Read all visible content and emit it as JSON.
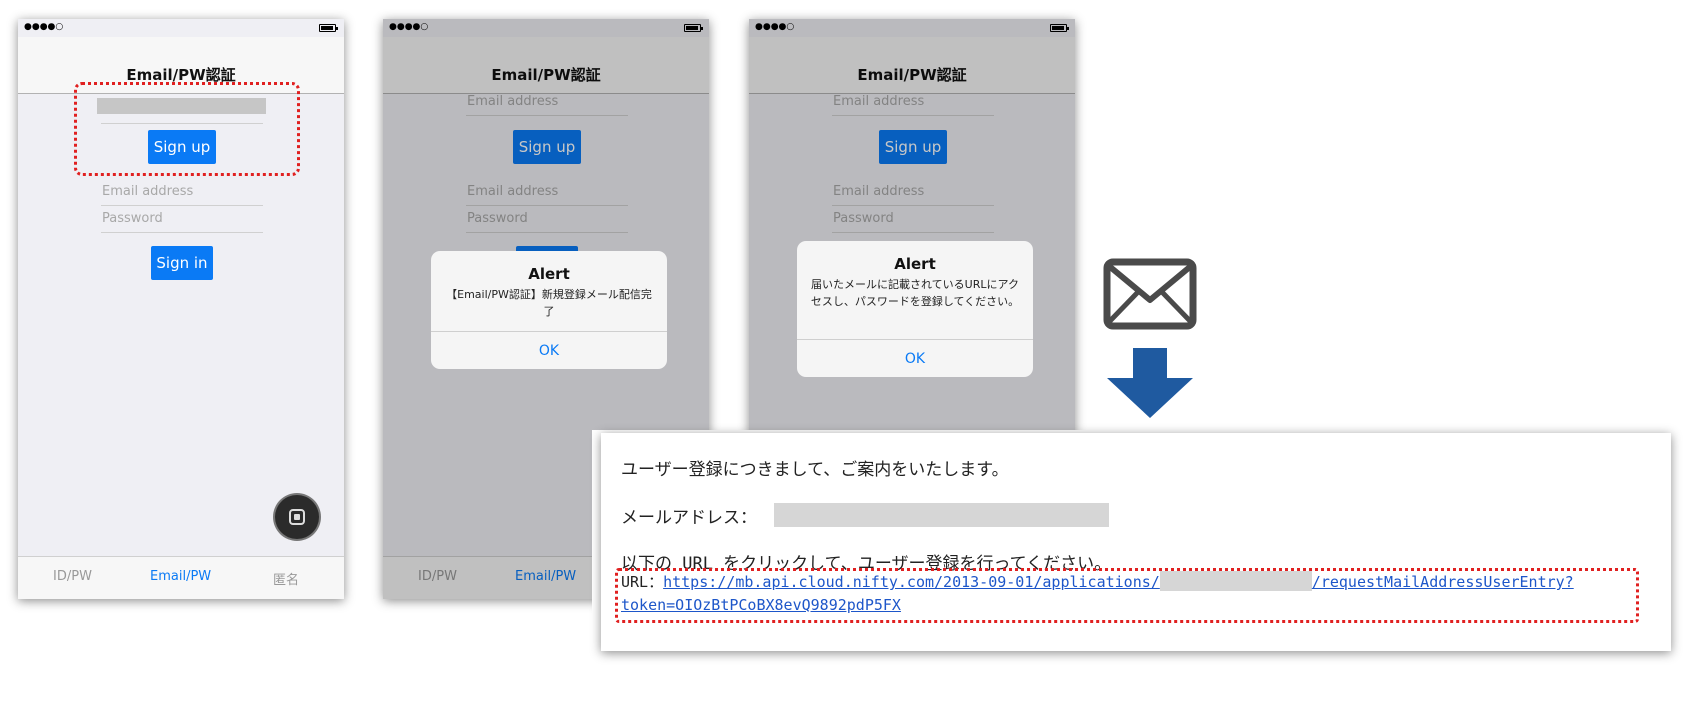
{
  "status": {
    "signal": "●●●●○"
  },
  "screen1": {
    "title": "Email/PW認証",
    "signup_label": "Sign up",
    "email_placeholder": "Email address",
    "password_placeholder": "Password",
    "signin_label": "Sign in",
    "tabs": [
      "ID/PW",
      "Email/PW",
      "匿名"
    ]
  },
  "screen2": {
    "title": "Email/PW認証",
    "email_placeholder_top": "Email address",
    "signup_label": "Sign up",
    "email_placeholder": "Email address",
    "password_placeholder": "Password",
    "alert": {
      "title": "Alert",
      "message": "【Email/PW認証】新規登録メール配信完了",
      "ok": "OK"
    },
    "tabs": [
      "ID/PW",
      "Email/PW"
    ]
  },
  "screen3": {
    "title": "Email/PW認証",
    "email_placeholder_top": "Email address",
    "signup_label": "Sign up",
    "email_placeholder": "Email address",
    "password_placeholder": "Password",
    "alert": {
      "title": "Alert",
      "message": "届いたメールに記載されているURLにアクセスし、パスワードを登録してください。",
      "ok": "OK"
    }
  },
  "email": {
    "line1": "ユーザー登録につきまして、ご案内をいたします。",
    "address_label": "メールアドレス：",
    "line3": "以下の URL をクリックして、ユーザー登録を行ってください。",
    "url_label": "URL：",
    "url_part1": "https://mb.api.cloud.nifty.com/2013-09-01/applications/",
    "url_part2": "/requestMailAddressUserEntry?",
    "url_part3": "token=OIOzBtPCoBX8evQ9892pdP5FX"
  },
  "colors": {
    "accent": "#0a7af5",
    "highlight": "#e02020",
    "arrow": "#1f5aa0"
  },
  "icons": [
    "mail-envelope-icon",
    "down-arrow-icon",
    "assistive-touch-icon"
  ]
}
